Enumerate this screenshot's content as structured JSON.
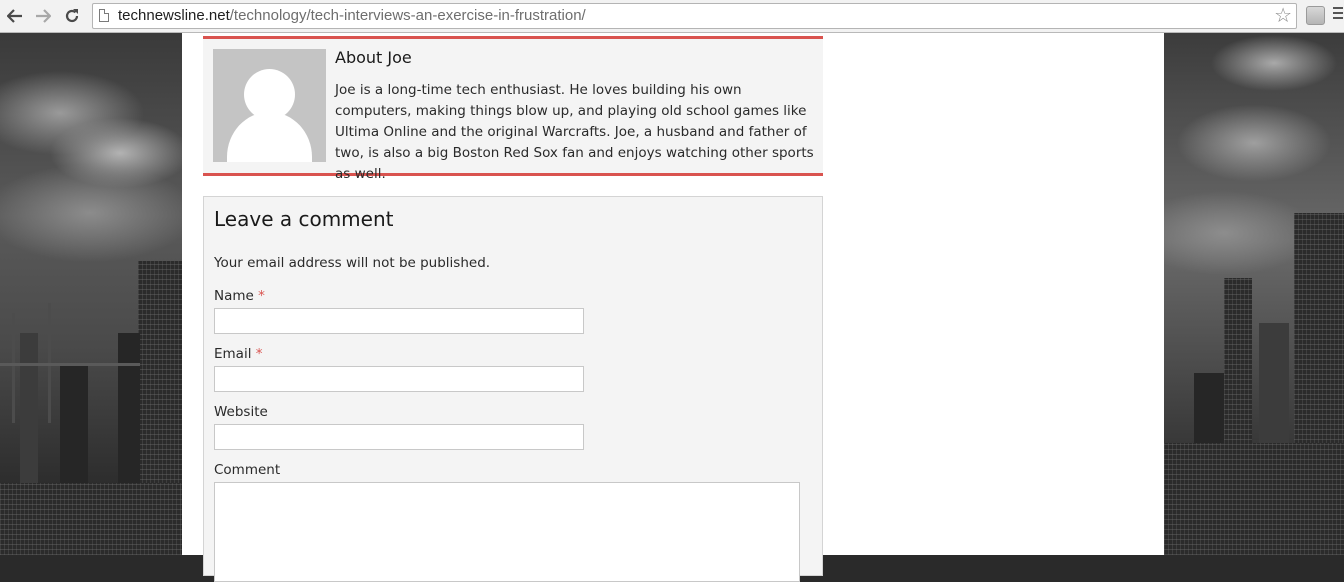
{
  "browser": {
    "back_icon": "arrow-left-icon",
    "forward_icon": "arrow-right-icon",
    "reload_icon": "reload-icon",
    "url_domain": "technewsline.net",
    "url_path": "/technology/tech-interviews-an-exercise-in-frustration/",
    "bookmark_icon": "star-icon",
    "menu_icon": "hamburger-menu-icon"
  },
  "author_box": {
    "title": "About Joe",
    "bio": "Joe is a long-time tech enthusiast. He loves building his own computers, making things blow up, and playing old school games like Ultima Online and the original Warcrafts. Joe, a husband and father of two, is also a big Boston Red Sox fan and enjoys watching other sports as well.",
    "accent_color": "#d9534f"
  },
  "comment_form": {
    "heading": "Leave a comment",
    "notes": "Your email address will not be published.",
    "required_marker": "*",
    "fields": {
      "name_label": "Name",
      "email_label": "Email",
      "website_label": "Website",
      "comment_label": "Comment"
    },
    "values": {
      "name": "",
      "email": "",
      "website": "",
      "comment": ""
    }
  }
}
